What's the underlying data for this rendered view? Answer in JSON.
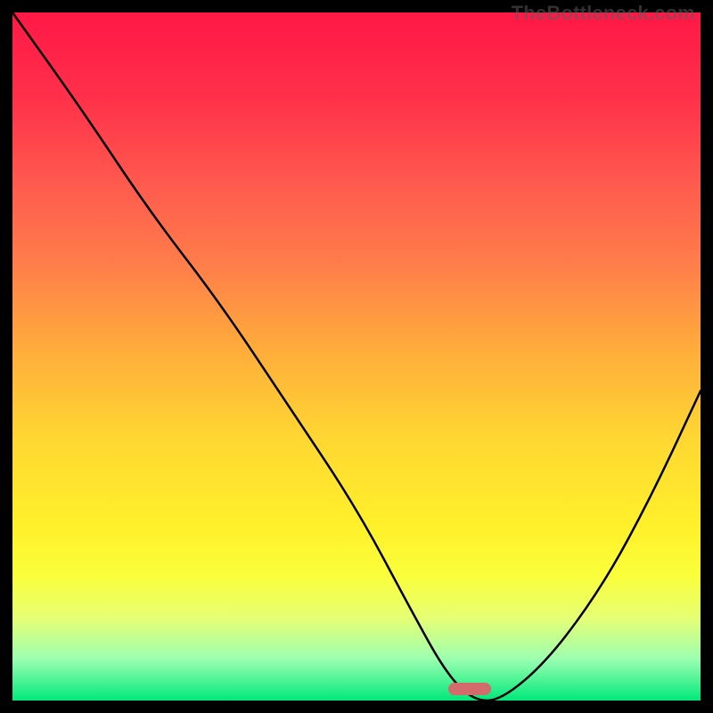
{
  "watermark": "TheBottleneck.com",
  "marker": {
    "x_frac": 0.665,
    "y_frac": 0.983,
    "color": "#d36a6b"
  },
  "chart_data": {
    "type": "line",
    "title": "",
    "xlabel": "",
    "ylabel": "",
    "xlim": [
      0,
      1
    ],
    "ylim": [
      0,
      1
    ],
    "annotations": [
      "TheBottleneck.com"
    ],
    "series": [
      {
        "name": "bottleneck-curve",
        "x": [
          0.0,
          0.1,
          0.2,
          0.3,
          0.4,
          0.5,
          0.58,
          0.63,
          0.67,
          0.71,
          0.78,
          0.86,
          0.93,
          1.0
        ],
        "values": [
          1.0,
          0.86,
          0.71,
          0.58,
          0.43,
          0.28,
          0.13,
          0.04,
          0.0,
          0.0,
          0.06,
          0.17,
          0.3,
          0.45
        ]
      }
    ],
    "background_gradient": {
      "top": "#ff1846",
      "upper_mid": "#ffb03a",
      "lower_mid": "#fff12a",
      "bottom": "#00e87a"
    },
    "minimum_marker": {
      "x": 0.665,
      "y": 0.017
    }
  }
}
